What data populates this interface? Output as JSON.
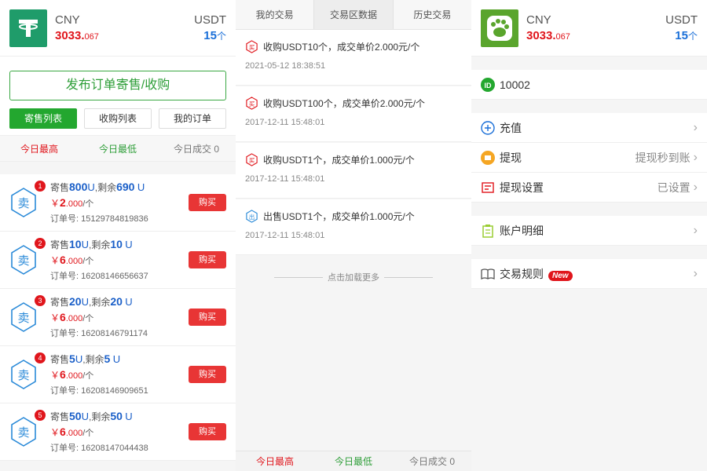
{
  "account": {
    "cny_label": "CNY",
    "cny_int": "3033.",
    "cny_dec": "067",
    "usdt_label": "USDT",
    "usdt_value": "15",
    "usdt_unit": "个"
  },
  "panel1": {
    "publish_label": "发布订单寄售/收购",
    "tabs": [
      "寄售列表",
      "收购列表",
      "我的订单"
    ],
    "stats": {
      "high": "今日最高",
      "low": "今日最低",
      "today": "今日成交 0"
    },
    "orders": [
      {
        "num": "1",
        "type": "卖",
        "sell_prefix": "寄售",
        "qty": "800",
        "u1": "U",
        "remain_prefix": ",剩余",
        "remain": "690",
        "u2": "U",
        "price_sym": "￥",
        "price_int": "2",
        "price_dec": ".000",
        "price_unit": "/个",
        "order_label": "订单号:",
        "order_no": "15129784819836",
        "buy_label": "购买"
      },
      {
        "num": "2",
        "type": "卖",
        "sell_prefix": "寄售",
        "qty": "10",
        "u1": "U",
        "remain_prefix": ",剩余",
        "remain": "10",
        "u2": "U",
        "price_sym": "￥",
        "price_int": "6",
        "price_dec": ".000",
        "price_unit": "/个",
        "order_label": "订单号:",
        "order_no": "16208146656637",
        "buy_label": "购买"
      },
      {
        "num": "3",
        "type": "卖",
        "sell_prefix": "寄售",
        "qty": "20",
        "u1": "U",
        "remain_prefix": ",剩余",
        "remain": "20",
        "u2": "U",
        "price_sym": "￥",
        "price_int": "6",
        "price_dec": ".000",
        "price_unit": "/个",
        "order_label": "订单号:",
        "order_no": "16208146791174",
        "buy_label": "购买"
      },
      {
        "num": "4",
        "type": "卖",
        "sell_prefix": "寄售",
        "qty": "5",
        "u1": "U",
        "remain_prefix": ",剩余",
        "remain": "5",
        "u2": "U",
        "price_sym": "￥",
        "price_int": "6",
        "price_dec": ".000",
        "price_unit": "/个",
        "order_label": "订单号:",
        "order_no": "16208146909651",
        "buy_label": "购买"
      },
      {
        "num": "5",
        "type": "卖",
        "sell_prefix": "寄售",
        "qty": "50",
        "u1": "U",
        "remain_prefix": ",剩余",
        "remain": "50",
        "u2": "U",
        "price_sym": "￥",
        "price_int": "6",
        "price_dec": ".000",
        "price_unit": "/个",
        "order_label": "订单号:",
        "order_no": "16208147044438",
        "buy_label": "购买"
      }
    ]
  },
  "panel2": {
    "tabs": [
      "我的交易",
      "交易区数据",
      "历史交易"
    ],
    "trades": [
      {
        "kind": "buy",
        "text": "收购USDT10个，成交单价2.000元/个",
        "time": "2021-05-12 18:38:51"
      },
      {
        "kind": "buy",
        "text": "收购USDT100个，成交单价2.000元/个",
        "time": "2017-12-11 15:48:01"
      },
      {
        "kind": "buy",
        "text": "收购USDT1个，成交单价1.000元/个",
        "time": "2017-12-11 15:48:01"
      },
      {
        "kind": "sell",
        "text": "出售USDT1个，成交单价1.000元/个",
        "time": "2017-12-11 15:48:01"
      }
    ],
    "load_more": "点击加载更多",
    "stats": {
      "high": "今日最高",
      "low": "今日最低",
      "today": "今日成交 0"
    }
  },
  "panel3": {
    "user_id": "10002",
    "menu": {
      "recharge": "充值",
      "withdraw": "提现",
      "withdraw_note": "提现秒到账",
      "withdraw_settings": "提现设置",
      "withdraw_settings_note": "已设置",
      "account_detail": "账户明细",
      "trade_rules": "交易规则",
      "new_badge": "New",
      "chevron": "›"
    }
  },
  "colors": {
    "green": "#23a72f",
    "red": "#e0161c",
    "blue": "#1a5fc8"
  }
}
